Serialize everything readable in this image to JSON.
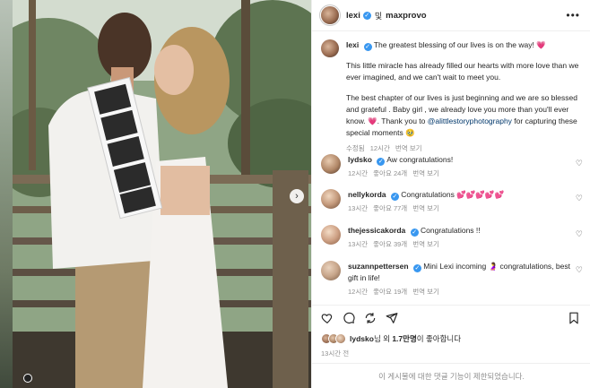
{
  "header": {
    "username": "lexi",
    "separator": "및",
    "collaborator": "maxprovo",
    "more_icon": "more-horizontal-icon"
  },
  "caption": {
    "username": "lexi",
    "line1": "The greatest blessing of our lives is on the way! 💗",
    "para1": "This little miracle has already filled our hearts with more love than we ever imagined, and we can't wait to meet you.",
    "para2_pre": "The best chapter of our lives is just beginning and we are so blessed and grateful . Baby girl , we already love you more than you'll ever know. 💗. Thank you to ",
    "mention": "@alittlestoryphotography",
    "para2_post": " for capturing these special moments 🥹",
    "meta": {
      "edited": "수정됨",
      "time": "12시간",
      "translate": "번역 보기"
    }
  },
  "comments": [
    {
      "username": "lydsko",
      "text": "Aw congratulations!",
      "time": "12시간",
      "likes": "좋아요 24개",
      "translate": "번역 보기"
    },
    {
      "username": "nellykorda",
      "text": "Congratulations 💕💕💕💕💕",
      "time": "13시간",
      "likes": "좋아요 77개",
      "translate": "번역 보기"
    },
    {
      "username": "thejessicakorda",
      "text": "Congratulations !!",
      "time": "13시간",
      "likes": "좋아요 39개",
      "translate": "번역 보기"
    },
    {
      "username": "suzannpettersen",
      "text": "Mini Lexi incoming 🤰 congratulations, best gift in life!",
      "time": "12시간",
      "likes": "좋아요 19개",
      "translate": "번역 보기"
    }
  ],
  "actions": [
    "heart-icon",
    "comment-icon",
    "share-icon",
    "send-icon",
    "bookmark-icon"
  ],
  "likes": {
    "user": "lydsko",
    "suffix": "님 외 ",
    "count": "1.7만명",
    "end": "이 좋아합니다"
  },
  "post_time": "13시간 전",
  "comments_restricted": "이 게시물에 대한 댓글 기능이 제한되었습니다."
}
